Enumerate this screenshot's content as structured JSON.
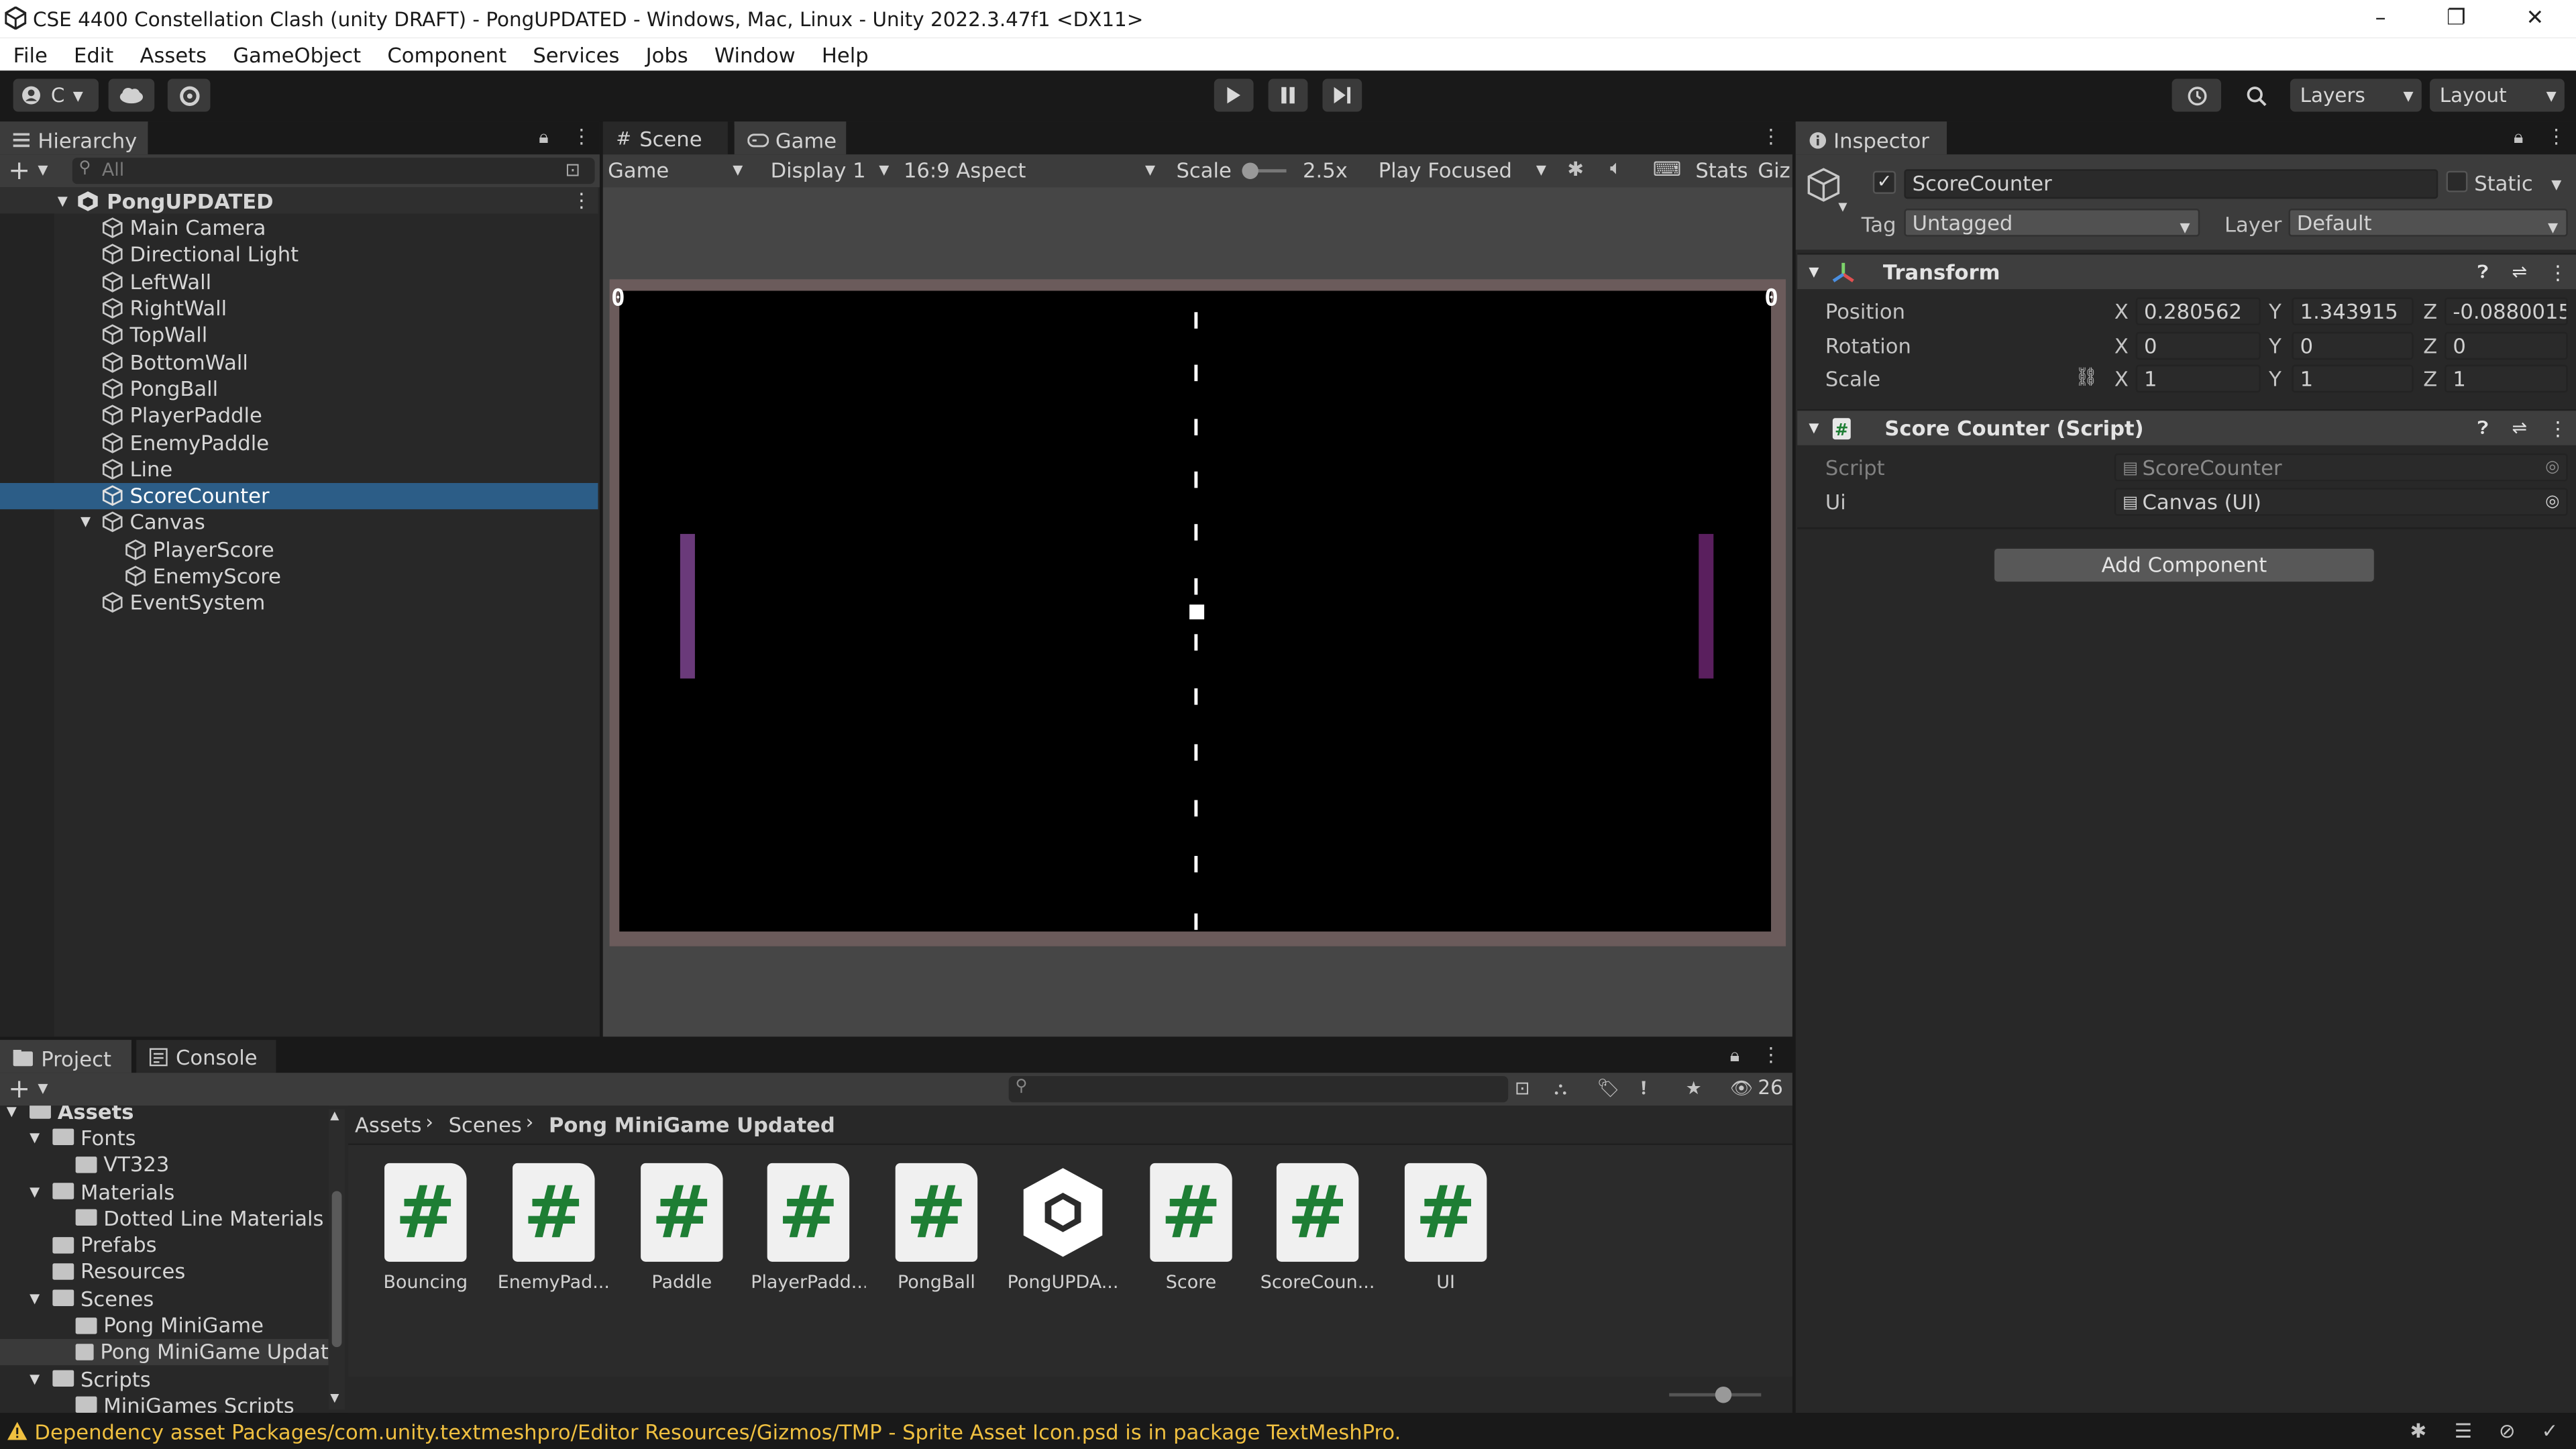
{
  "window": {
    "title": "CSE 4400 Constellation Clash (unity DRAFT) - PongUPDATED - Windows, Mac, Linux - Unity 2022.3.47f1 <DX11>",
    "minimize": "–",
    "maximize": "❐",
    "close": "✕"
  },
  "menu": [
    "File",
    "Edit",
    "Assets",
    "GameObject",
    "Component",
    "Services",
    "Jobs",
    "Window",
    "Help"
  ],
  "toolbar": {
    "account_label": "C",
    "layers_label": "Layers",
    "layout_label": "Layout"
  },
  "hierarchy": {
    "tab_label": "Hierarchy",
    "search_placeholder": "All",
    "scene_name": "PongUPDATED",
    "items": [
      {
        "label": "Main Camera"
      },
      {
        "label": "Directional Light"
      },
      {
        "label": "LeftWall"
      },
      {
        "label": "RightWall"
      },
      {
        "label": "TopWall"
      },
      {
        "label": "BottomWall"
      },
      {
        "label": "PongBall"
      },
      {
        "label": "PlayerPaddle"
      },
      {
        "label": "EnemyPaddle"
      },
      {
        "label": "Line"
      },
      {
        "label": "ScoreCounter"
      },
      {
        "label": "Canvas"
      },
      {
        "label": "PlayerScore"
      },
      {
        "label": "EnemyScore"
      },
      {
        "label": "EventSystem"
      }
    ]
  },
  "game_view": {
    "tab_scene": "Scene",
    "tab_game": "Game",
    "mode": "Game",
    "display": "Display 1",
    "aspect": "16:9 Aspect",
    "scale_label": "Scale",
    "scale_value": "2.5x",
    "play_mode": "Play Focused",
    "stats_label": "Stats",
    "gizmos_label": "Giz",
    "player_score": "0",
    "enemy_score": "0"
  },
  "inspector": {
    "tab_label": "Inspector",
    "object_name": "ScoreCounter",
    "static_label": "Static",
    "tag_label": "Tag",
    "tag_value": "Untagged",
    "layer_label": "Layer",
    "layer_value": "Default",
    "transform": {
      "title": "Transform",
      "position_label": "Position",
      "rotation_label": "Rotation",
      "scale_label": "Scale",
      "position": {
        "x": "0.280562",
        "y": "1.343915",
        "z": "-0.0880015"
      },
      "rotation": {
        "x": "0",
        "y": "0",
        "z": "0"
      },
      "scale": {
        "x": "1",
        "y": "1",
        "z": "1"
      }
    },
    "script_component": {
      "title": "Score Counter (Script)",
      "script_label": "Script",
      "script_value": "ScoreCounter",
      "ui_label": "Ui",
      "ui_value": "Canvas (UI)"
    },
    "add_component": "Add Component"
  },
  "project": {
    "tab_project": "Project",
    "tab_console": "Console",
    "hidden_count": "26",
    "breadcrumb": [
      "Assets",
      "Scenes",
      "Pong MiniGame Updated"
    ],
    "tree": [
      {
        "label": "Assets",
        "level": 0
      },
      {
        "label": "Fonts",
        "level": 1
      },
      {
        "label": "VT323",
        "level": 2
      },
      {
        "label": "Materials",
        "level": 1
      },
      {
        "label": "Dotted Line Materials",
        "level": 2
      },
      {
        "label": "Prefabs",
        "level": 1
      },
      {
        "label": "Resources",
        "level": 1
      },
      {
        "label": "Scenes",
        "level": 1
      },
      {
        "label": "Pong MiniGame",
        "level": 2
      },
      {
        "label": "Pong MiniGame Updat",
        "level": 2
      },
      {
        "label": "Scripts",
        "level": 1
      },
      {
        "label": "MiniGames Scripts",
        "level": 2
      }
    ],
    "assets": [
      {
        "name": "Bouncing",
        "icon": "script-icon"
      },
      {
        "name": "EnemyPad...",
        "icon": "script-icon"
      },
      {
        "name": "Paddle",
        "icon": "script-icon"
      },
      {
        "name": "PlayerPadd...",
        "icon": "script-icon"
      },
      {
        "name": "PongBall",
        "icon": "script-icon"
      },
      {
        "name": "PongUPDA...",
        "icon": "unity-scene-icon"
      },
      {
        "name": "Score",
        "icon": "script-icon"
      },
      {
        "name": "ScoreCoun...",
        "icon": "script-icon"
      },
      {
        "name": "UI",
        "icon": "script-icon"
      }
    ]
  },
  "status": {
    "message": "Dependency asset Packages/com.unity.textmeshpro/Editor Resources/Gizmos/TMP - Sprite Asset Icon.psd is in package TextMeshPro."
  },
  "colors": {
    "selection": "#2c5d87",
    "panel": "#282828",
    "script_hash": "#1e7e34",
    "paddle_left": "#6a3a7a",
    "paddle_right": "#5a1f5e",
    "game_border": "#6b5b5b"
  }
}
